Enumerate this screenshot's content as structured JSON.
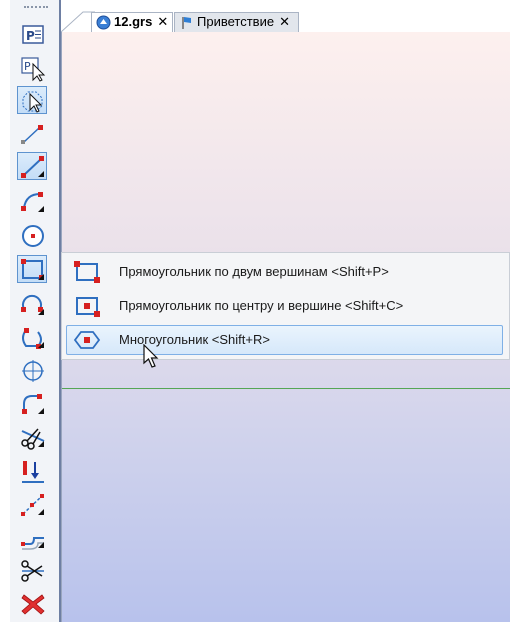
{
  "tabs": [
    {
      "label": "12.grs",
      "close": "✕",
      "icon": "document-3d-icon",
      "active": true
    },
    {
      "label": "Приветствие",
      "close": "✕",
      "icon": "flag-icon",
      "active": false
    }
  ],
  "toolbar": {
    "tools": [
      {
        "name": "parameters-window-icon"
      },
      {
        "name": "parameters-select-icon"
      },
      {
        "name": "select-pointer-icon"
      },
      {
        "name": "node-line-icon"
      },
      {
        "name": "line-segment-icon"
      },
      {
        "name": "arc-icon"
      },
      {
        "name": "circle-icon"
      },
      {
        "name": "rectangle-icon"
      },
      {
        "name": "arc-segment-icon"
      },
      {
        "name": "curve-icon"
      },
      {
        "name": "crosshair-circle-icon"
      },
      {
        "name": "fillet-icon"
      },
      {
        "name": "trim-scissors-icon"
      },
      {
        "name": "dimension-icon"
      },
      {
        "name": "spline-icon"
      },
      {
        "name": "offset-curve-icon"
      },
      {
        "name": "cut-scissors-icon"
      },
      {
        "name": "delete-x-icon"
      }
    ]
  },
  "flyout": {
    "items": [
      {
        "label": "Прямоугольник по двум вершинам <Shift+P>",
        "icon": "rectangle-two-corners-icon"
      },
      {
        "label": "Прямоугольник по центру и вершине <Shift+C>",
        "icon": "rectangle-center-icon"
      },
      {
        "label": "Многоугольник <Shift+R>",
        "icon": "polygon-icon"
      }
    ]
  },
  "colors": {
    "accent": "#5e93cf",
    "marker": "#d62020",
    "axis": "#55a655"
  }
}
